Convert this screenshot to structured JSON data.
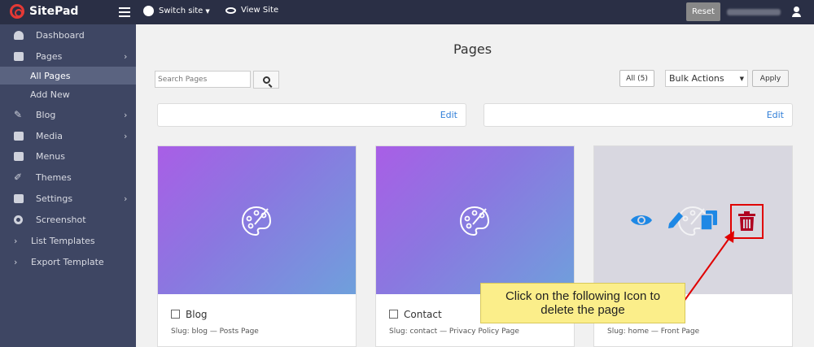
{
  "topbar": {
    "app_name": "SitePad",
    "switch_site": "Switch site",
    "view_site": "View Site",
    "reset": "Reset"
  },
  "sidebar": {
    "items": [
      {
        "label": "Dashboard",
        "icon": "dashboard-icon"
      },
      {
        "label": "Pages",
        "icon": "pages-icon"
      },
      {
        "label": "All Pages"
      },
      {
        "label": "Add New"
      },
      {
        "label": "Blog",
        "icon": "pin-icon"
      },
      {
        "label": "Media",
        "icon": "media-icon"
      },
      {
        "label": "Menus",
        "icon": "menus-icon"
      },
      {
        "label": "Themes",
        "icon": "themes-icon"
      },
      {
        "label": "Settings",
        "icon": "settings-icon"
      },
      {
        "label": "Screenshot",
        "icon": "gear-icon"
      },
      {
        "label": "List Templates",
        "icon": "chevron-right-icon"
      },
      {
        "label": "Export Template",
        "icon": "chevron-right-icon"
      }
    ]
  },
  "main": {
    "title": "Pages",
    "search_placeholder": "Search Pages",
    "all_filter": "All (5)",
    "bulk_actions": "Bulk Actions",
    "apply": "Apply",
    "edit_label": "Edit"
  },
  "cards": [
    {
      "title": "Blog",
      "slug": "Slug: blog — Posts Page"
    },
    {
      "title": "Contact",
      "slug": "Slug: contact — Privacy Policy Page"
    },
    {
      "title": "",
      "slug": "Slug: home — Front Page"
    }
  ],
  "callout": {
    "text": "Click on the following Icon to delete the page"
  },
  "colors": {
    "topbar": "#2a2f45",
    "sidebar": "#3e4663",
    "active_item": "#5a6380",
    "link": "#2f7ed8",
    "action_icon": "#1e88e5",
    "trash": "#b00020",
    "highlight": "#e00000",
    "callout": "#fbee8a"
  }
}
